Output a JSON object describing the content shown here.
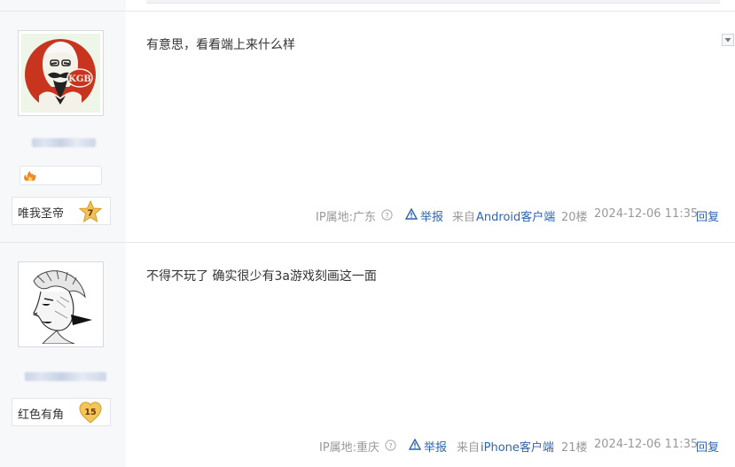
{
  "posts": [
    {
      "username_display": "",
      "honor_title": "唯我圣帝",
      "level": "7",
      "level_color": "#e8a93b",
      "content": "有意思，看看端上来什么样",
      "meta": {
        "ip_label": "IP属地:广东",
        "report": "举报",
        "source_prefix": "来自",
        "source_client": "Android客户端",
        "floor": "20楼",
        "time": "2024-12-06 11:35",
        "reply": "回复"
      }
    },
    {
      "username_display": "",
      "honor_title": "红色有角",
      "level": "15",
      "level_color": "#e8b93b",
      "content": "不得不玩了 确实很少有3a游戏刻画这一面",
      "meta": {
        "ip_label": "IP属地:重庆",
        "report": "举报",
        "source_prefix": "来自",
        "source_client": "iPhone客户端",
        "floor": "21楼",
        "time": "2024-12-06 11:35",
        "reply": "回复"
      }
    }
  ],
  "icons": {
    "collapse": "triangle-down-icon",
    "help": "question-circle-icon",
    "report": "warning-triangle-icon",
    "honor": "flame-icon"
  },
  "avatar_logo_text": "KGB",
  "colors": {
    "link_blue": "#2d64b3",
    "meta_gray": "#999999",
    "sidebar_bg": "#f7f8fa"
  }
}
